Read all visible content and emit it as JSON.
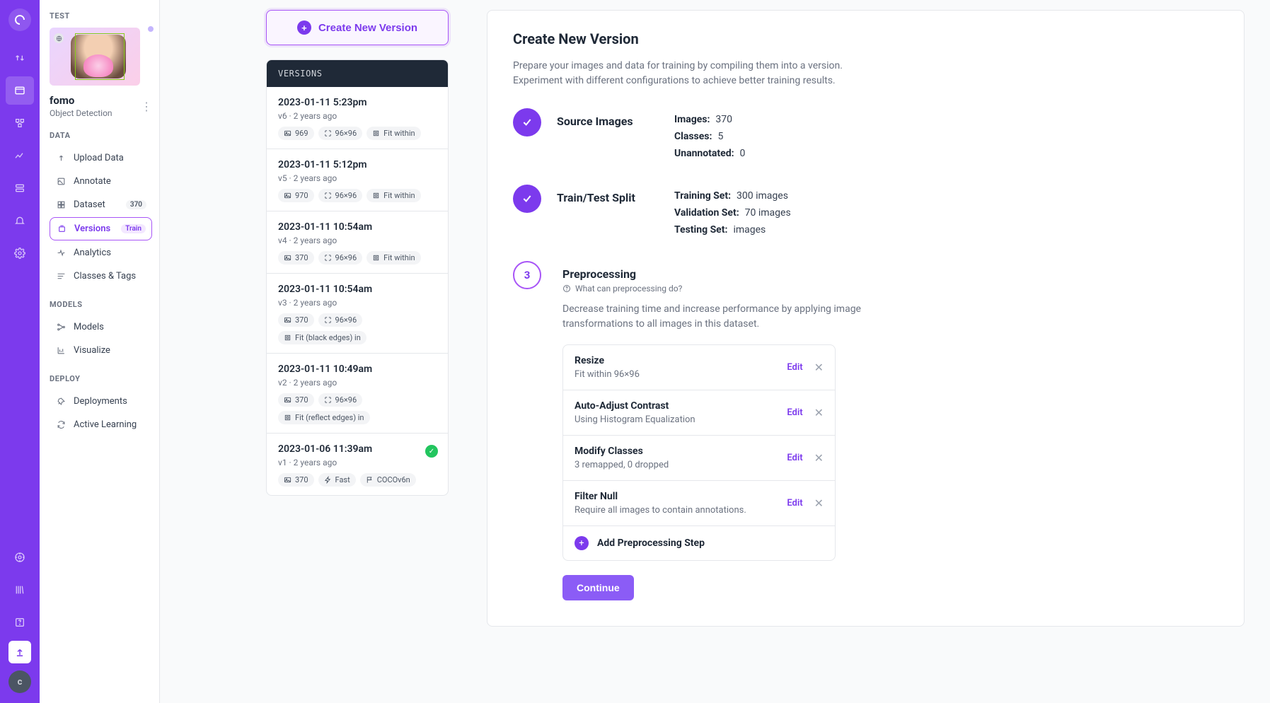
{
  "rail": {
    "avatar_letter": "c"
  },
  "sidebar": {
    "workspace_label": "TEST",
    "project_name": "fomo",
    "project_type": "Object Detection",
    "sections": {
      "data_label": "DATA",
      "models_label": "MODELS",
      "deploy_label": "DEPLOY"
    },
    "items": {
      "upload": "Upload Data",
      "annotate": "Annotate",
      "dataset": "Dataset",
      "dataset_count": "370",
      "versions": "Versions",
      "versions_badge": "Train",
      "analytics": "Analytics",
      "classes": "Classes & Tags",
      "models_item": "Models",
      "visualize": "Visualize",
      "deployments": "Deployments",
      "active_learning": "Active Learning"
    }
  },
  "create_btn": "Create New Version",
  "versions_header": "VERSIONS",
  "versions_list": [
    {
      "title": "2023-01-11 5:23pm",
      "sub": "v6 · 2 years ago",
      "pills": [
        {
          "icon": "image",
          "text": "969"
        },
        {
          "icon": "resize",
          "text": "96×96"
        },
        {
          "icon": "fit",
          "text": "Fit within"
        }
      ],
      "check": false
    },
    {
      "title": "2023-01-11 5:12pm",
      "sub": "v5 · 2 years ago",
      "pills": [
        {
          "icon": "image",
          "text": "970"
        },
        {
          "icon": "resize",
          "text": "96×96"
        },
        {
          "icon": "fit",
          "text": "Fit within"
        }
      ],
      "check": false
    },
    {
      "title": "2023-01-11 10:54am",
      "sub": "v4 · 2 years ago",
      "pills": [
        {
          "icon": "image",
          "text": "370"
        },
        {
          "icon": "resize",
          "text": "96×96"
        },
        {
          "icon": "fit",
          "text": "Fit within"
        }
      ],
      "check": false
    },
    {
      "title": "2023-01-11 10:54am",
      "sub": "v3 · 2 years ago",
      "pills": [
        {
          "icon": "image",
          "text": "370"
        },
        {
          "icon": "resize",
          "text": "96×96"
        },
        {
          "icon": "fit",
          "text": "Fit (black edges) in"
        }
      ],
      "check": false
    },
    {
      "title": "2023-01-11 10:49am",
      "sub": "v2 · 2 years ago",
      "pills": [
        {
          "icon": "image",
          "text": "370"
        },
        {
          "icon": "resize",
          "text": "96×96"
        },
        {
          "icon": "fit",
          "text": "Fit (reflect edges) in"
        }
      ],
      "check": false
    },
    {
      "title": "2023-01-06 11:39am",
      "sub": "v1 · 2 years ago",
      "pills": [
        {
          "icon": "image",
          "text": "370"
        },
        {
          "icon": "fast",
          "text": "Fast"
        },
        {
          "icon": "flag",
          "text": "COCOv6n"
        }
      ],
      "check": true
    }
  ],
  "content": {
    "title": "Create New Version",
    "desc1": "Prepare your images and data for training by compiling them into a version.",
    "desc2": "Experiment with different configurations to achieve better training results.",
    "step1": {
      "title": "Source Images",
      "images_key": "Images:",
      "images_val": "370",
      "classes_key": "Classes:",
      "classes_val": "5",
      "unannotated_key": "Unannotated:",
      "unannotated_val": "0"
    },
    "step2": {
      "title": "Train/Test Split",
      "training_key": "Training Set:",
      "training_val": "300 images",
      "validation_key": "Validation Set:",
      "validation_val": "70 images",
      "testing_key": "Testing Set:",
      "testing_val": "images"
    },
    "step3": {
      "number": "3",
      "title": "Preprocessing",
      "help": "What can preprocessing do?",
      "para": "Decrease training time and increase performance by applying image transformations to all images in this dataset.",
      "items": [
        {
          "name": "Resize",
          "sub": "Fit within 96×96"
        },
        {
          "name": "Auto-Adjust Contrast",
          "sub": "Using Histogram Equalization"
        },
        {
          "name": "Modify Classes",
          "sub": "3 remapped, 0 dropped"
        },
        {
          "name": "Filter Null",
          "sub": "Require all images to contain annotations."
        }
      ],
      "edit_label": "Edit",
      "add_label": "Add Preprocessing Step"
    },
    "continue_btn": "Continue"
  }
}
